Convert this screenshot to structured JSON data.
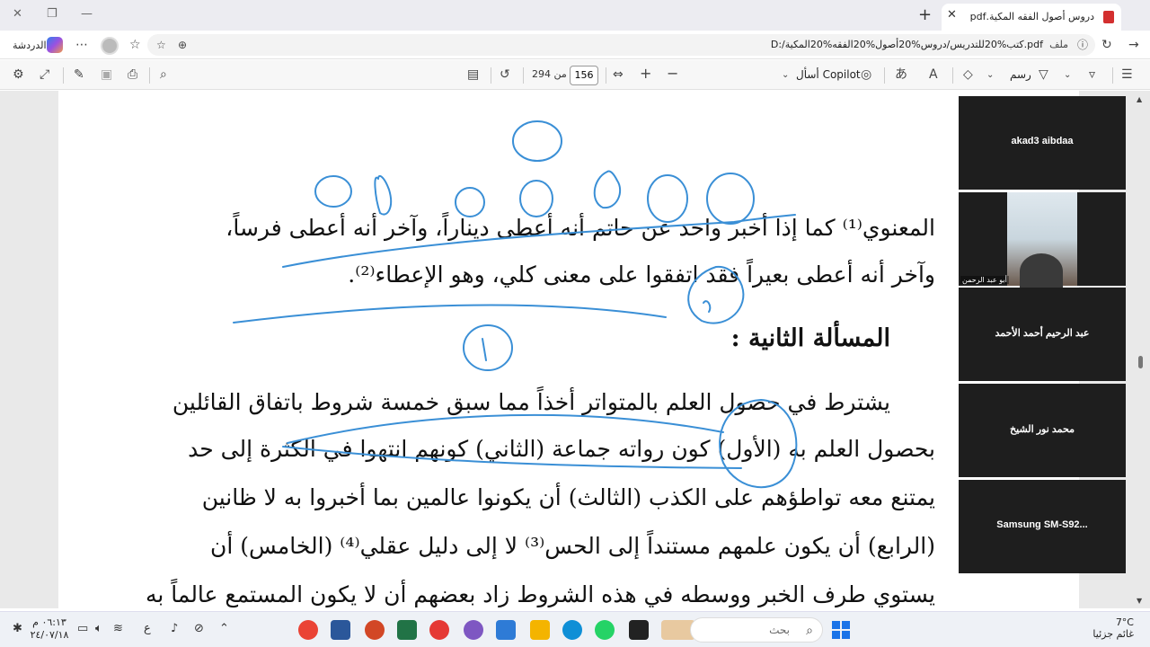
{
  "tabbar": {
    "tab_title": "دروس أصول الفقه المكية.pdf",
    "close_glyph": "✕",
    "new_tab_glyph": "+"
  },
  "addressbar": {
    "chat_label": "الدردشة",
    "file_label": "ملف",
    "url": "D:/كتب%20للتدريس/دروس%20أصول%20الفقه%20المكية.pdf"
  },
  "pdf_toolbar": {
    "page_current": "156",
    "page_total": "من 294",
    "copilot_label": "أسأل Copilot",
    "draw_label": "رسم"
  },
  "document": {
    "lines": [
      "المعنوي⁽¹⁾ كما إذا أخبر واحد عن حاتم أنه أعطى ديناراً، وآخر أنه أعطى فرساً،",
      "وآخر أنه أعطى بعيراً فقد اتفقوا على معنى كلي، وهو الإعطاء⁽²⁾.",
      "يشترط في حصول العلم بالمتواتر أخذاً مما سبق خمسة شروط باتفاق القائلين",
      "بحصول العلم به (الأول) كون رواته جماعة (الثاني) كونهم انتهوا في الكثرة إلى حد",
      "يمتنع معه تواطؤهم على الكذب (الثالث) أن يكونوا عالمين بما أخبروا به لا ظانين",
      "(الرابع) أن يكون علمهم مستنداً إلى الحس⁽³⁾ لا إلى دليل عقلي⁽⁴⁾ (الخامس) أن",
      "يستوي طرف الخبر ووسطه في هذه الشروط زاد بعضهم أن لا يكون المستمع عالماً به"
    ],
    "heading": "المسألة الثانية :"
  },
  "participants": [
    {
      "name": "akad3 aibdaa",
      "video": false
    },
    {
      "name": "",
      "video": true,
      "video_label": "أبو عبد الرحمن"
    },
    {
      "name": "عبد الرحيم أحمد الأحمد",
      "video": false
    },
    {
      "name": "محمد نور الشيخ",
      "video": false
    },
    {
      "name": "Samsung  SM-S92...",
      "video": false
    }
  ],
  "taskbar": {
    "search_placeholder": "بحث",
    "weather_temp": "7°C",
    "weather_desc": "غائم جزئيا",
    "time": "٠٦:١٣ م",
    "date": "٢٤/٠٧/١٨"
  },
  "colors": {
    "ink": "#3a8fd6",
    "pdf_red": "#d32f2f",
    "tile_bg": "#1e1e1e"
  }
}
